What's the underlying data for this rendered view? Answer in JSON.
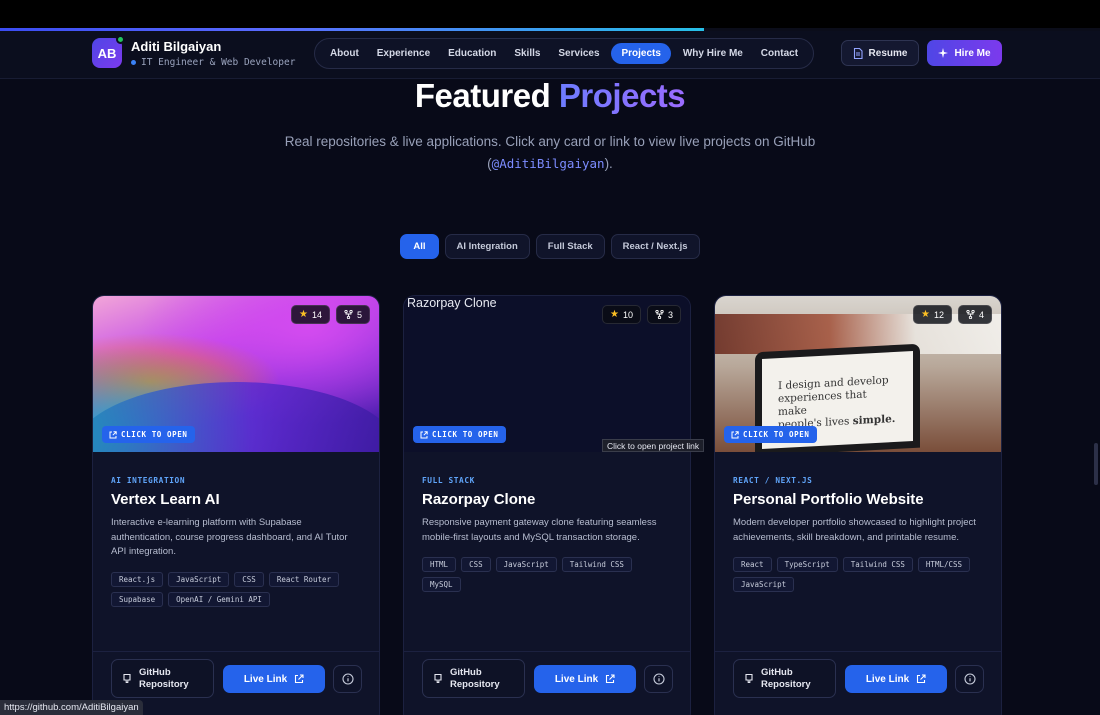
{
  "scroll_progress_percent": 64,
  "brand": {
    "initials": "AB",
    "name": "Aditi Bilgaiyan",
    "role": "IT Engineer & Web Developer",
    "online": true
  },
  "nav": {
    "items": [
      "About",
      "Experience",
      "Education",
      "Skills",
      "Services",
      "Projects",
      "Why Hire Me",
      "Contact"
    ],
    "active": "Projects",
    "resume_label": "Resume",
    "hire_label": "Hire Me"
  },
  "section": {
    "title_plain": "Featured",
    "title_accent": "Projects",
    "subtitle": "Real repositories & live applications. Click any card or link to view live projects on GitHub (",
    "handle": "@AditiBilgaiyan",
    "subtitle_end": ")."
  },
  "filters": [
    "All",
    "AI Integration",
    "Full Stack",
    "React / Next.js"
  ],
  "active_filter": "All",
  "cards": [
    {
      "stars": "14",
      "forks": "5",
      "open_label": "CLICK TO OPEN",
      "category": "AI INTEGRATION",
      "title": "Vertex Learn AI",
      "description": "Interactive e-learning platform with Supabase authentication, course progress dashboard, and AI Tutor API integration.",
      "tags": [
        "React.js",
        "JavaScript",
        "CSS",
        "React Router",
        "Supabase",
        "OpenAI / Gemini API"
      ],
      "github_label_1": "GitHub",
      "github_label_2": "Repository",
      "live_label": "Live Link"
    },
    {
      "image_alt": "Razorpay Clone",
      "stars": "10",
      "forks": "3",
      "open_label": "CLICK TO OPEN",
      "category": "FULL STACK",
      "title": "Razorpay Clone",
      "description": "Responsive payment gateway clone featuring seamless mobile-first layouts and MySQL transaction storage.",
      "tags": [
        "HTML",
        "CSS",
        "JavaScript",
        "Tailwind CSS",
        "MySQL"
      ],
      "github_label_1": "GitHub",
      "github_label_2": "Repository",
      "live_label": "Live Link"
    },
    {
      "screen_text_1": "I design and develop",
      "screen_text_2": "experiences that make",
      "screen_text_3": "people's lives",
      "screen_text_bold": "simple.",
      "stars": "12",
      "forks": "4",
      "open_label": "CLICK TO OPEN",
      "category": "REACT / NEXT.JS",
      "title": "Personal Portfolio Website",
      "description": "Modern developer portfolio showcased to highlight project achievements, skill breakdown, and printable resume.",
      "tags": [
        "React",
        "TypeScript",
        "Tailwind CSS",
        "HTML/CSS",
        "JavaScript"
      ],
      "github_label_1": "GitHub",
      "github_label_2": "Repository",
      "live_label": "Live Link"
    }
  ],
  "tooltip": "Click to open project link",
  "status_url": "https://github.com/AditiBilgaiyan",
  "colors": {
    "accent": "#2563eb",
    "brand_gradient_start": "#4f46e5",
    "brand_gradient_end": "#7c3aed",
    "category": "#60a5fa",
    "background": "#080a18"
  }
}
